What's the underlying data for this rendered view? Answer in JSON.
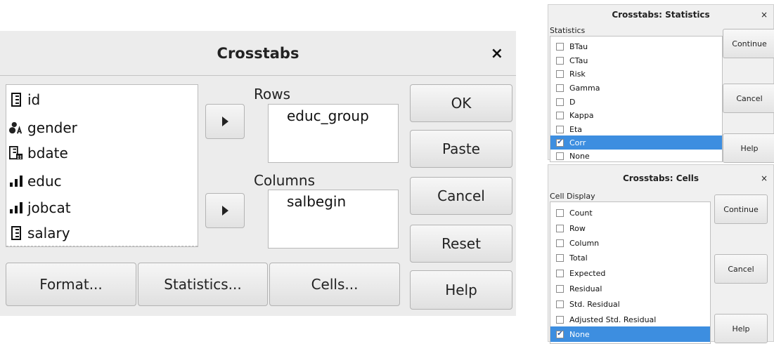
{
  "crosstabs": {
    "title": "Crosstabs",
    "close": "×",
    "variables": [
      {
        "name": "id",
        "icon": "scale-ruler-icon"
      },
      {
        "name": "gender",
        "icon": "nominal-people-icon"
      },
      {
        "name": "bdate",
        "icon": "date-ruler-icon"
      },
      {
        "name": "educ",
        "icon": "ordinal-bars-icon"
      },
      {
        "name": "jobcat",
        "icon": "ordinal-bars-icon"
      },
      {
        "name": "salary",
        "icon": "scale-ruler-icon"
      }
    ],
    "rows_label": "Rows",
    "rows_value": "educ_group",
    "columns_label": "Columns",
    "columns_value": "salbegin",
    "buttons": {
      "ok": "OK",
      "paste": "Paste",
      "cancel": "Cancel",
      "reset": "Reset",
      "help": "Help"
    },
    "bottom_buttons": {
      "format": "Format...",
      "statistics": "Statistics...",
      "cells": "Cells..."
    }
  },
  "statistics_dialog": {
    "title": "Crosstabs: Statistics",
    "close": "×",
    "group_label": "Statistics",
    "items": [
      {
        "label": "BTau",
        "checked": false,
        "selected": false
      },
      {
        "label": "CTau",
        "checked": false,
        "selected": false
      },
      {
        "label": "Risk",
        "checked": false,
        "selected": false
      },
      {
        "label": "Gamma",
        "checked": false,
        "selected": false
      },
      {
        "label": "D",
        "checked": false,
        "selected": false
      },
      {
        "label": "Kappa",
        "checked": false,
        "selected": false
      },
      {
        "label": "Eta",
        "checked": false,
        "selected": false
      },
      {
        "label": "Corr",
        "checked": true,
        "selected": true
      },
      {
        "label": "None",
        "checked": false,
        "selected": false
      }
    ],
    "buttons": {
      "continue": "Continue",
      "cancel": "Cancel",
      "help": "Help"
    }
  },
  "cells_dialog": {
    "title": "Crosstabs: Cells",
    "close": "×",
    "group_label": "Cell Display",
    "items": [
      {
        "label": "Count",
        "checked": false,
        "selected": false
      },
      {
        "label": "Row",
        "checked": false,
        "selected": false
      },
      {
        "label": "Column",
        "checked": false,
        "selected": false
      },
      {
        "label": "Total",
        "checked": false,
        "selected": false
      },
      {
        "label": "Expected",
        "checked": false,
        "selected": false
      },
      {
        "label": "Residual",
        "checked": false,
        "selected": false
      },
      {
        "label": "Std. Residual",
        "checked": false,
        "selected": false
      },
      {
        "label": "Adjusted Std. Residual",
        "checked": false,
        "selected": false
      },
      {
        "label": "None",
        "checked": true,
        "selected": true
      }
    ],
    "buttons": {
      "continue": "Continue",
      "cancel": "Cancel",
      "help": "Help"
    }
  }
}
